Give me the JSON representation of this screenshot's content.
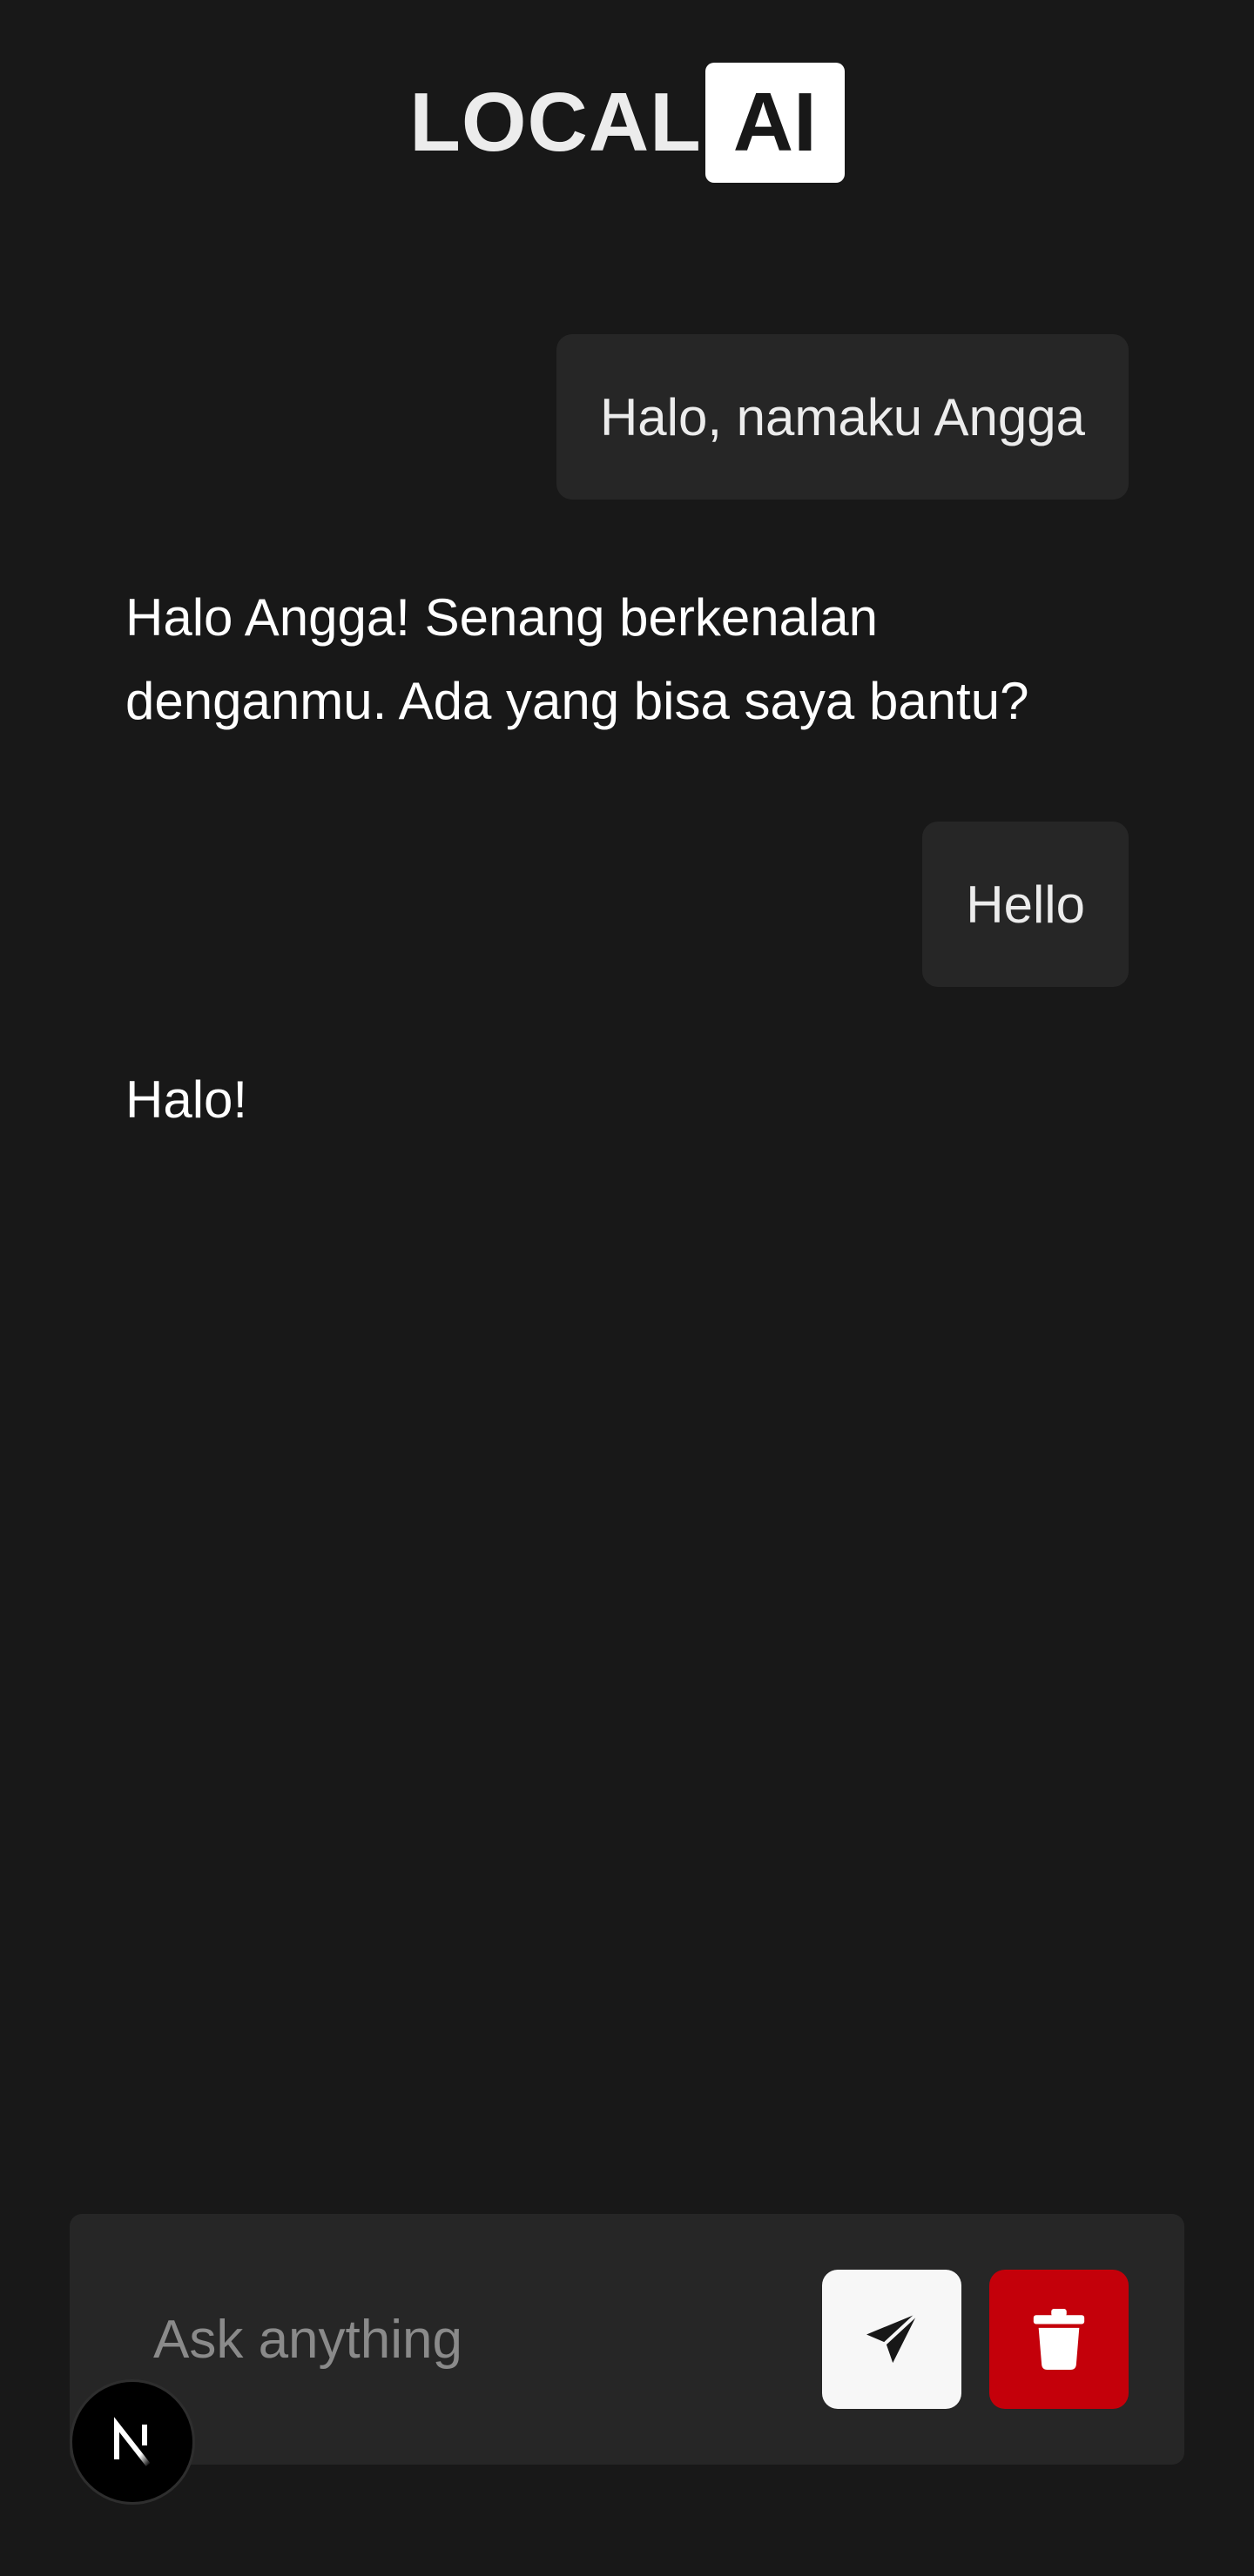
{
  "header": {
    "logo_text": "LOCAL",
    "logo_badge": "AI"
  },
  "conversation": [
    {
      "role": "user",
      "text": "Halo, namaku Angga"
    },
    {
      "role": "assistant",
      "text": "Halo Angga! Senang berkenalan denganmu. Ada yang bisa saya bantu?"
    },
    {
      "role": "user",
      "text": "Hello"
    },
    {
      "role": "assistant",
      "text": "Halo!"
    }
  ],
  "composer": {
    "value": "",
    "placeholder": "Ask anything",
    "send_icon": "paper-plane-icon",
    "clear_icon": "trash-icon"
  },
  "dev_badge": {
    "label": "N"
  },
  "colors": {
    "background": "#181818",
    "bubble": "#262626",
    "send_button": "#f7f7f7",
    "clear_button": "#c4000a"
  }
}
